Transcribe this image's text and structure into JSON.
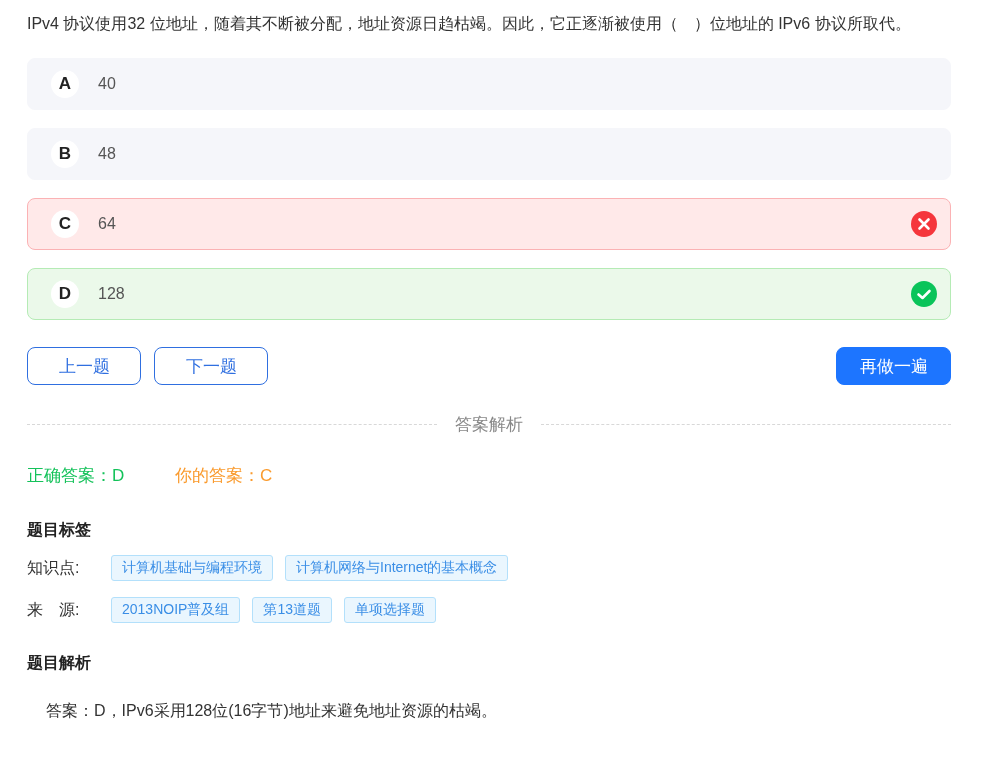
{
  "question": "IPv4 协议使用32 位地址，随着其不断被分配，地址资源日趋枯竭。因此，它正逐渐被使用（　）位地址的 IPv6 协议所取代。",
  "options": [
    {
      "letter": "A",
      "text": "40",
      "kind": "plain"
    },
    {
      "letter": "B",
      "text": "48",
      "kind": "plain"
    },
    {
      "letter": "C",
      "text": "64",
      "kind": "wrong"
    },
    {
      "letter": "D",
      "text": "128",
      "kind": "correct"
    }
  ],
  "nav_buttons": [
    {
      "label": "上一题",
      "kind": "outline"
    },
    {
      "label": "下一题",
      "kind": "outline"
    },
    {
      "label": "再做一遍",
      "kind": "primary"
    }
  ],
  "divider_label": "答案解析",
  "correct_answer": {
    "label": "正确答案：",
    "value": "D"
  },
  "your_answer": {
    "label": "你的答案：",
    "value": "C"
  },
  "tags_section": {
    "title": "题目标签",
    "rows": [
      {
        "label": "知识点:",
        "tags": [
          "计算机基础与编程环境",
          "计算机网络与Internet的基本概念"
        ]
      },
      {
        "label": "来　源:",
        "tags": [
          "2013NOIP普及组",
          "第13道题",
          "单项选择题"
        ]
      }
    ]
  },
  "analysis_section": {
    "title": "题目解析",
    "text": "答案：D，IPv6采用128位(16字节)地址来避免地址资源的枯竭。"
  }
}
